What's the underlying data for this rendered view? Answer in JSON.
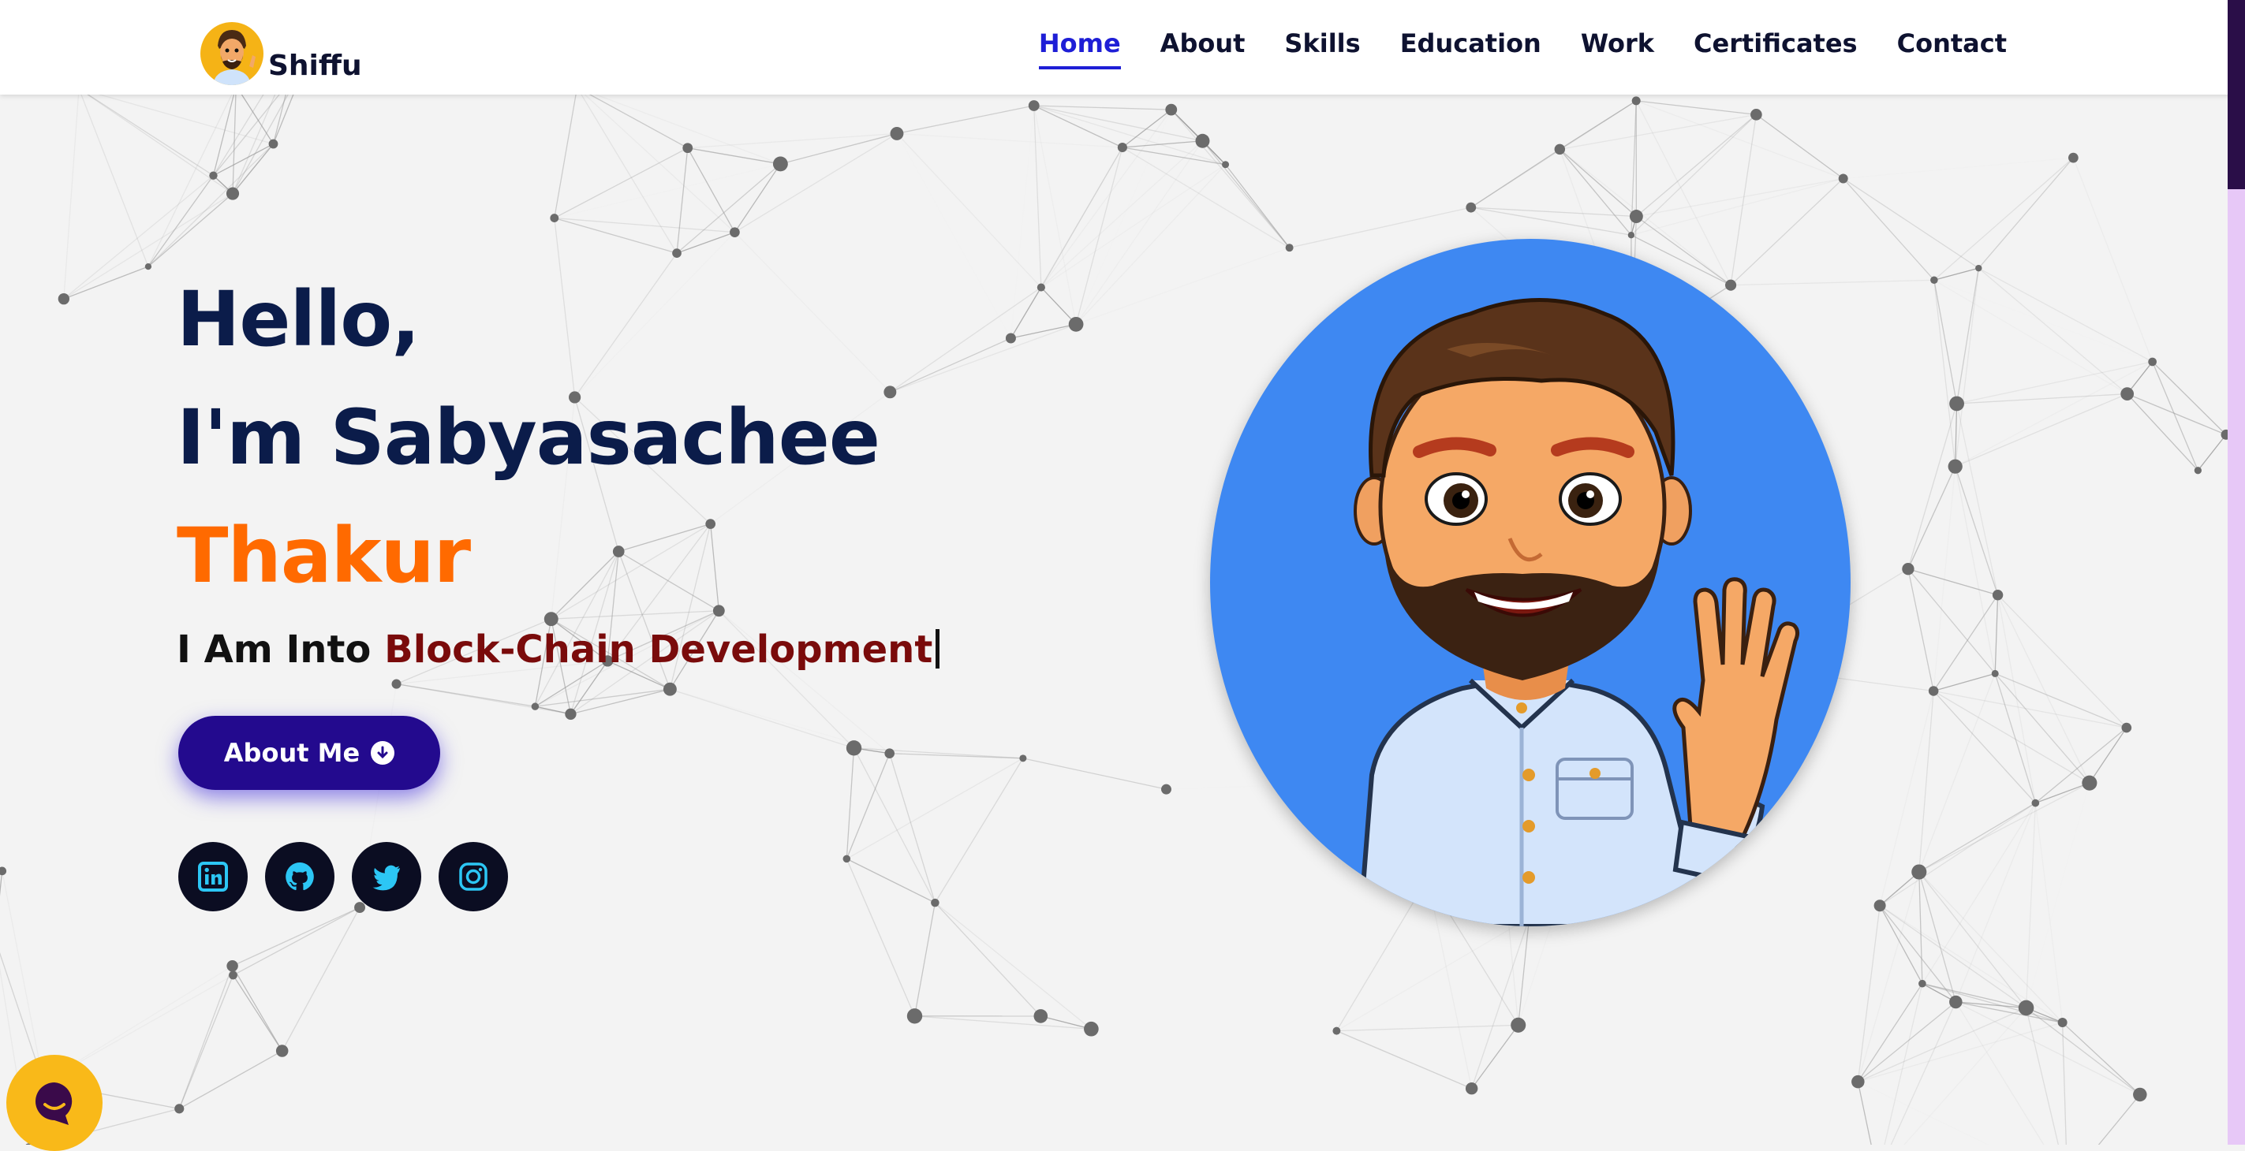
{
  "brand": {
    "name": "Shiffu",
    "logo_icon": "memoji-avatar-icon"
  },
  "nav": {
    "items": [
      {
        "label": "Home",
        "active": true
      },
      {
        "label": "About"
      },
      {
        "label": "Skills"
      },
      {
        "label": "Education"
      },
      {
        "label": "Work"
      },
      {
        "label": "Certificates"
      },
      {
        "label": "Contact"
      }
    ]
  },
  "hero": {
    "greeting": "Hello,",
    "intro": "I'm Sabyasachee",
    "last_name": "Thakur",
    "typing_prefix": "I Am Into ",
    "typing_text": "Block-Chain Development",
    "about_button": "About Me",
    "socials": [
      {
        "icon": "linkedin-icon"
      },
      {
        "icon": "github-icon"
      },
      {
        "icon": "twitter-icon"
      },
      {
        "icon": "instagram-icon"
      }
    ]
  },
  "avatar_icon": "waving-memoji-avatar-icon",
  "chat_icon": "chat-bubble-icon",
  "colors": {
    "nav_active": "#1e1ed6",
    "name_dark": "#0b1c4a",
    "name_accent": "#ff6a00",
    "typed_text": "#7a0b0b",
    "button_bg": "#230a8e",
    "avatar_bg": "#3e88f2",
    "social_icon": "#2cc6f5",
    "chat_bg": "#f9b919"
  }
}
